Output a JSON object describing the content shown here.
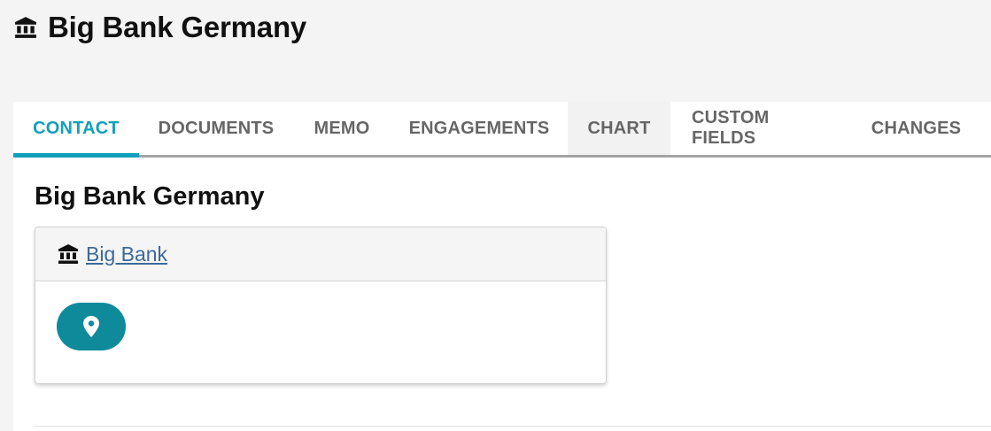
{
  "header": {
    "title": "Big Bank Germany",
    "icon": "bank-icon"
  },
  "tabs": [
    {
      "label": "CONTACT",
      "active": true
    },
    {
      "label": "DOCUMENTS",
      "active": false
    },
    {
      "label": "MEMO",
      "active": false
    },
    {
      "label": "ENGAGEMENTS",
      "active": false
    },
    {
      "label": "CHART",
      "active": false
    },
    {
      "label": "CUSTOM FIELDS",
      "active": false
    },
    {
      "label": "CHANGES",
      "active": false
    }
  ],
  "content": {
    "section_title": "Big Bank Germany",
    "card": {
      "icon": "bank-icon",
      "link_label": "Big Bank",
      "map_button_icon": "map-pin-icon"
    }
  },
  "colors": {
    "accent": "#11a0bb",
    "map_button": "#0e8a9b",
    "link": "#3b6a98"
  }
}
